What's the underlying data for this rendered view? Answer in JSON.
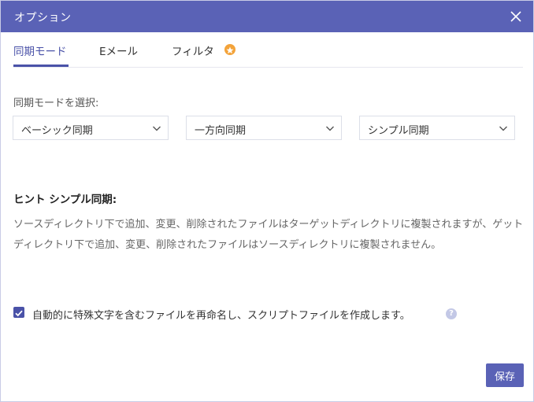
{
  "dialog": {
    "title": "オプション",
    "close_icon": "close-icon"
  },
  "tabs": [
    {
      "label": "同期モード",
      "active": true
    },
    {
      "label": "Eメール",
      "active": false
    },
    {
      "label": "フィルタ",
      "active": false,
      "badge_icon": "star-icon"
    }
  ],
  "sync": {
    "label": "同期モードを選択:",
    "selects": [
      {
        "value": "ベーシック同期"
      },
      {
        "value": "一方向同期"
      },
      {
        "value": "シンプル同期"
      }
    ]
  },
  "hint": {
    "title": "ヒント シンプル同期:",
    "text": "ソースディレクトリ下で追加、変更、削除されたファイルはターゲットディレクトリに複製されますが、ゲットディレクトリ下で追加、変更、削除されたファイルはソースディレクトリに複製されません。"
  },
  "option": {
    "checked": true,
    "label": "自動的に特殊文字を含むファイルを再命名し、スクリプトファイルを作成します。",
    "help_icon": "question-icon"
  },
  "footer": {
    "save_label": "保存"
  },
  "colors": {
    "titlebar": "#5a62b6",
    "accent": "#4a52a8",
    "star": "#f3a33a",
    "help": "#c3c8e6"
  }
}
